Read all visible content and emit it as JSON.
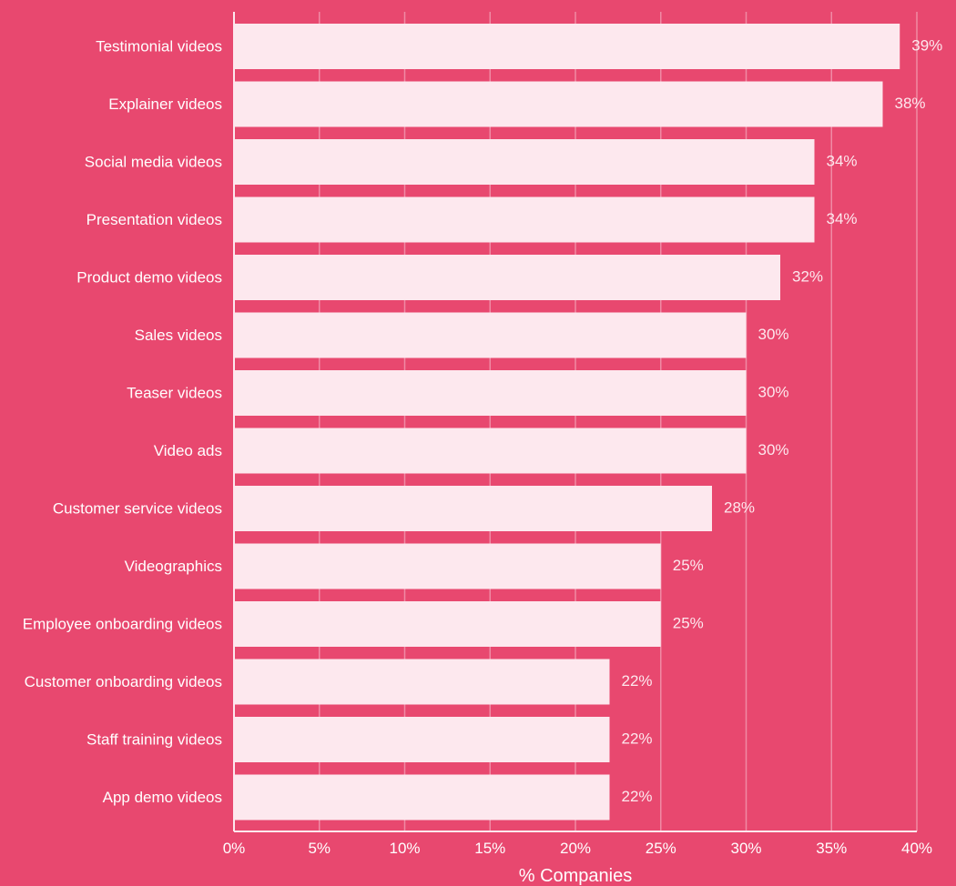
{
  "chart_data": {
    "type": "bar",
    "orientation": "horizontal",
    "title": "",
    "xlabel": "% Companies",
    "ylabel": "",
    "xlim": [
      0,
      40
    ],
    "grid": true,
    "categories": [
      "Testimonial videos",
      "Explainer videos",
      "Social media videos",
      "Presentation videos",
      "Product demo videos",
      "Sales videos",
      "Teaser videos",
      "Video ads",
      "Customer service videos",
      "Videographics",
      "Employee onboarding videos",
      "Customer onboarding videos",
      "Staff training videos",
      "App demo videos"
    ],
    "values": [
      39,
      38,
      34,
      34,
      32,
      30,
      30,
      30,
      28,
      25,
      25,
      22,
      22,
      22
    ],
    "value_labels": [
      "39%",
      "38%",
      "34%",
      "34%",
      "32%",
      "30%",
      "30%",
      "30%",
      "28%",
      "25%",
      "25%",
      "22%",
      "22%",
      "22%"
    ],
    "x_ticks": [
      0,
      5,
      10,
      15,
      20,
      25,
      30,
      35,
      40
    ],
    "x_tick_labels": [
      "0%",
      "5%",
      "10%",
      "15%",
      "20%",
      "25%",
      "30%",
      "35%",
      "40%"
    ],
    "colors": {
      "background": "#E8486F",
      "bar": "#FDE8EE",
      "text": "#FFFFFF",
      "grid": "#F08AA4"
    }
  }
}
